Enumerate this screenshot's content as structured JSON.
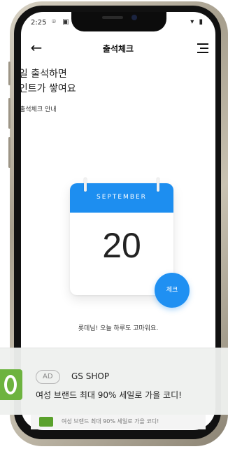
{
  "status": {
    "time": "2:25",
    "left_icons": "⌾ ▣",
    "right_icons": "▾ ▮"
  },
  "header": {
    "back_icon": "←",
    "title": "출석체크",
    "menu_icon": "menu-icon"
  },
  "headline": {
    "line1": "매일 출석하면",
    "line2": "포인트가 쌓여요"
  },
  "info": {
    "icon": "i",
    "label": "출석체크 안내"
  },
  "calendar": {
    "month": "SEPTEMBER",
    "day": "20",
    "accent": "#1d8ef0"
  },
  "check_button": {
    "label": "체크"
  },
  "message": "롯데님! 오늘 하루도 고마워요.",
  "inner_ad": {
    "text": "여성 브랜드 최대 90% 세일로 가을 코디!"
  },
  "ad": {
    "tag": "AD",
    "advertiser": "GS SHOP",
    "copy": "여성 브랜드 최대 90% 세일로 가을 코디!",
    "brand_color": "#6db33f"
  }
}
